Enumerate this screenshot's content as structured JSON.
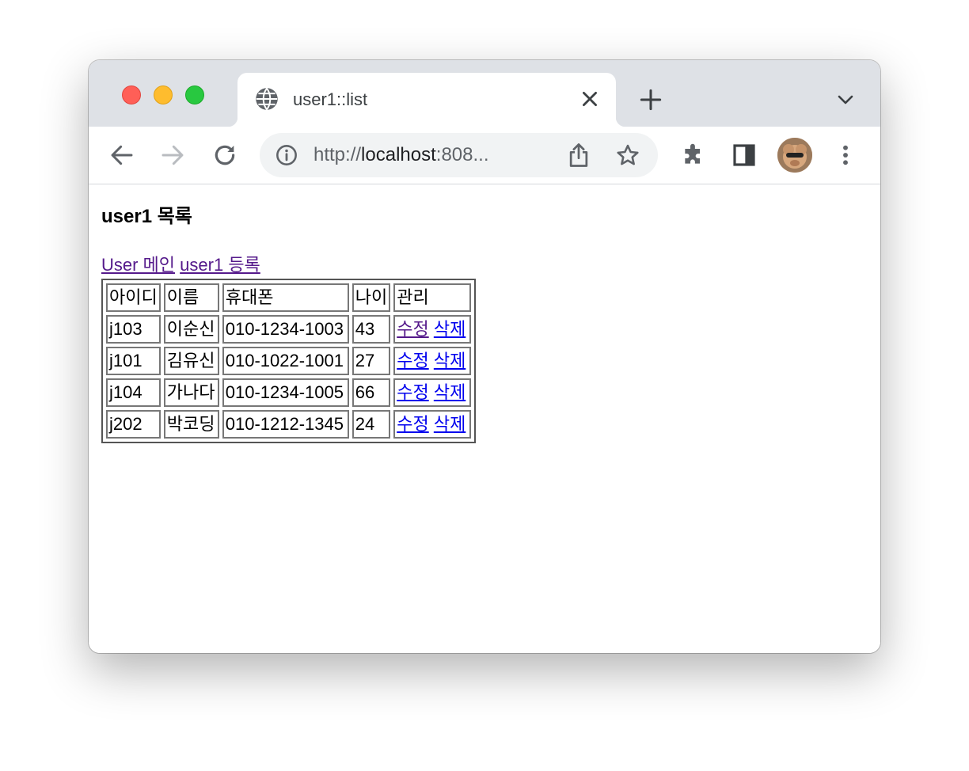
{
  "browser": {
    "tab": {
      "title": "user1::list"
    },
    "address_bar": {
      "url_scheme": "http://",
      "url_host": "localhost",
      "url_rest": ":808..."
    }
  },
  "page": {
    "title": "user1 목록",
    "nav_links": [
      {
        "label": "User 메인"
      },
      {
        "label": "user1 등록"
      }
    ],
    "table": {
      "headers": [
        "아이디",
        "이름",
        "휴대폰",
        "나이",
        "관리"
      ],
      "rows": [
        {
          "id": "j103",
          "name": "이순신",
          "phone": "010-1234-1003",
          "age": "43",
          "edit": "수정",
          "delete": "삭제"
        },
        {
          "id": "j101",
          "name": "김유신",
          "phone": "010-1022-1001",
          "age": "27",
          "edit": "수정",
          "delete": "삭제"
        },
        {
          "id": "j104",
          "name": "가나다",
          "phone": "010-1234-1005",
          "age": "66",
          "edit": "수정",
          "delete": "삭제"
        },
        {
          "id": "j202",
          "name": "박코딩",
          "phone": "010-1212-1345",
          "age": "24",
          "edit": "수정",
          "delete": "삭제"
        }
      ]
    }
  },
  "colors": {
    "visited_link": "#551a8b",
    "link": "#0000ee",
    "tabstrip": "#dee1e6"
  },
  "icons": {
    "tab_favicon": "globe-icon",
    "tab_close": "close-icon",
    "new_tab": "plus-icon",
    "tab_menu": "chevron-down-icon",
    "back": "back-arrow-icon",
    "forward": "forward-arrow-icon",
    "reload": "reload-icon",
    "site_info": "info-icon",
    "share": "share-icon",
    "bookmark": "star-icon",
    "extensions": "puzzle-icon",
    "side_panel": "side-panel-icon",
    "profile": "avatar",
    "menu": "kebab-menu-icon"
  }
}
